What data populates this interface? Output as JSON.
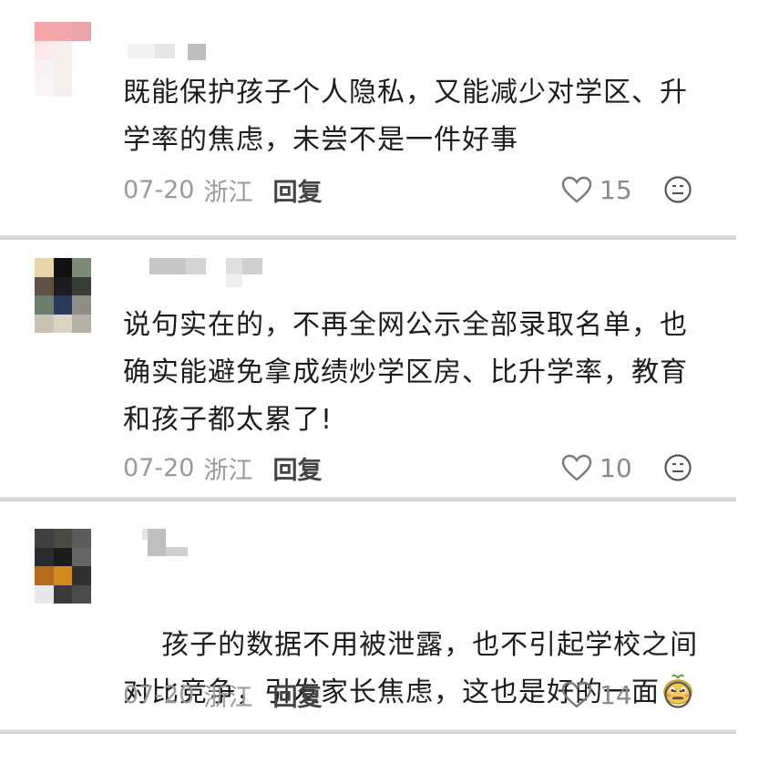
{
  "comments": [
    {
      "text": "既能保护孩子个人隐私，又能减少对学区、升学率的焦虑，未尝不是一件好事",
      "date": "07-20",
      "location": "浙江",
      "reply_label": "回复",
      "likes": "15"
    },
    {
      "text": "说句实在的，不再全网公示全部录取名单，也确实能避免拿成绩炒学区房、比升学率，教育和孩子都太累了!",
      "date": "07-20",
      "location": "浙江",
      "reply_label": "回复",
      "likes": "10"
    },
    {
      "text": "孩子的数据不用被泄露，也不引起学校之间对比竞争，引发家长焦虑，这也是好的一面",
      "date": "07-20",
      "location": "浙江",
      "reply_label": "回复",
      "likes": "14",
      "emoji": "smiling-character-emoji"
    }
  ],
  "icons": {
    "like": "heart-outline-icon",
    "reaction": "smiley-face-icon"
  },
  "colors": {
    "text": "#1c1c1c",
    "meta": "#9a9a9a",
    "separator": "#d6d6d6"
  }
}
